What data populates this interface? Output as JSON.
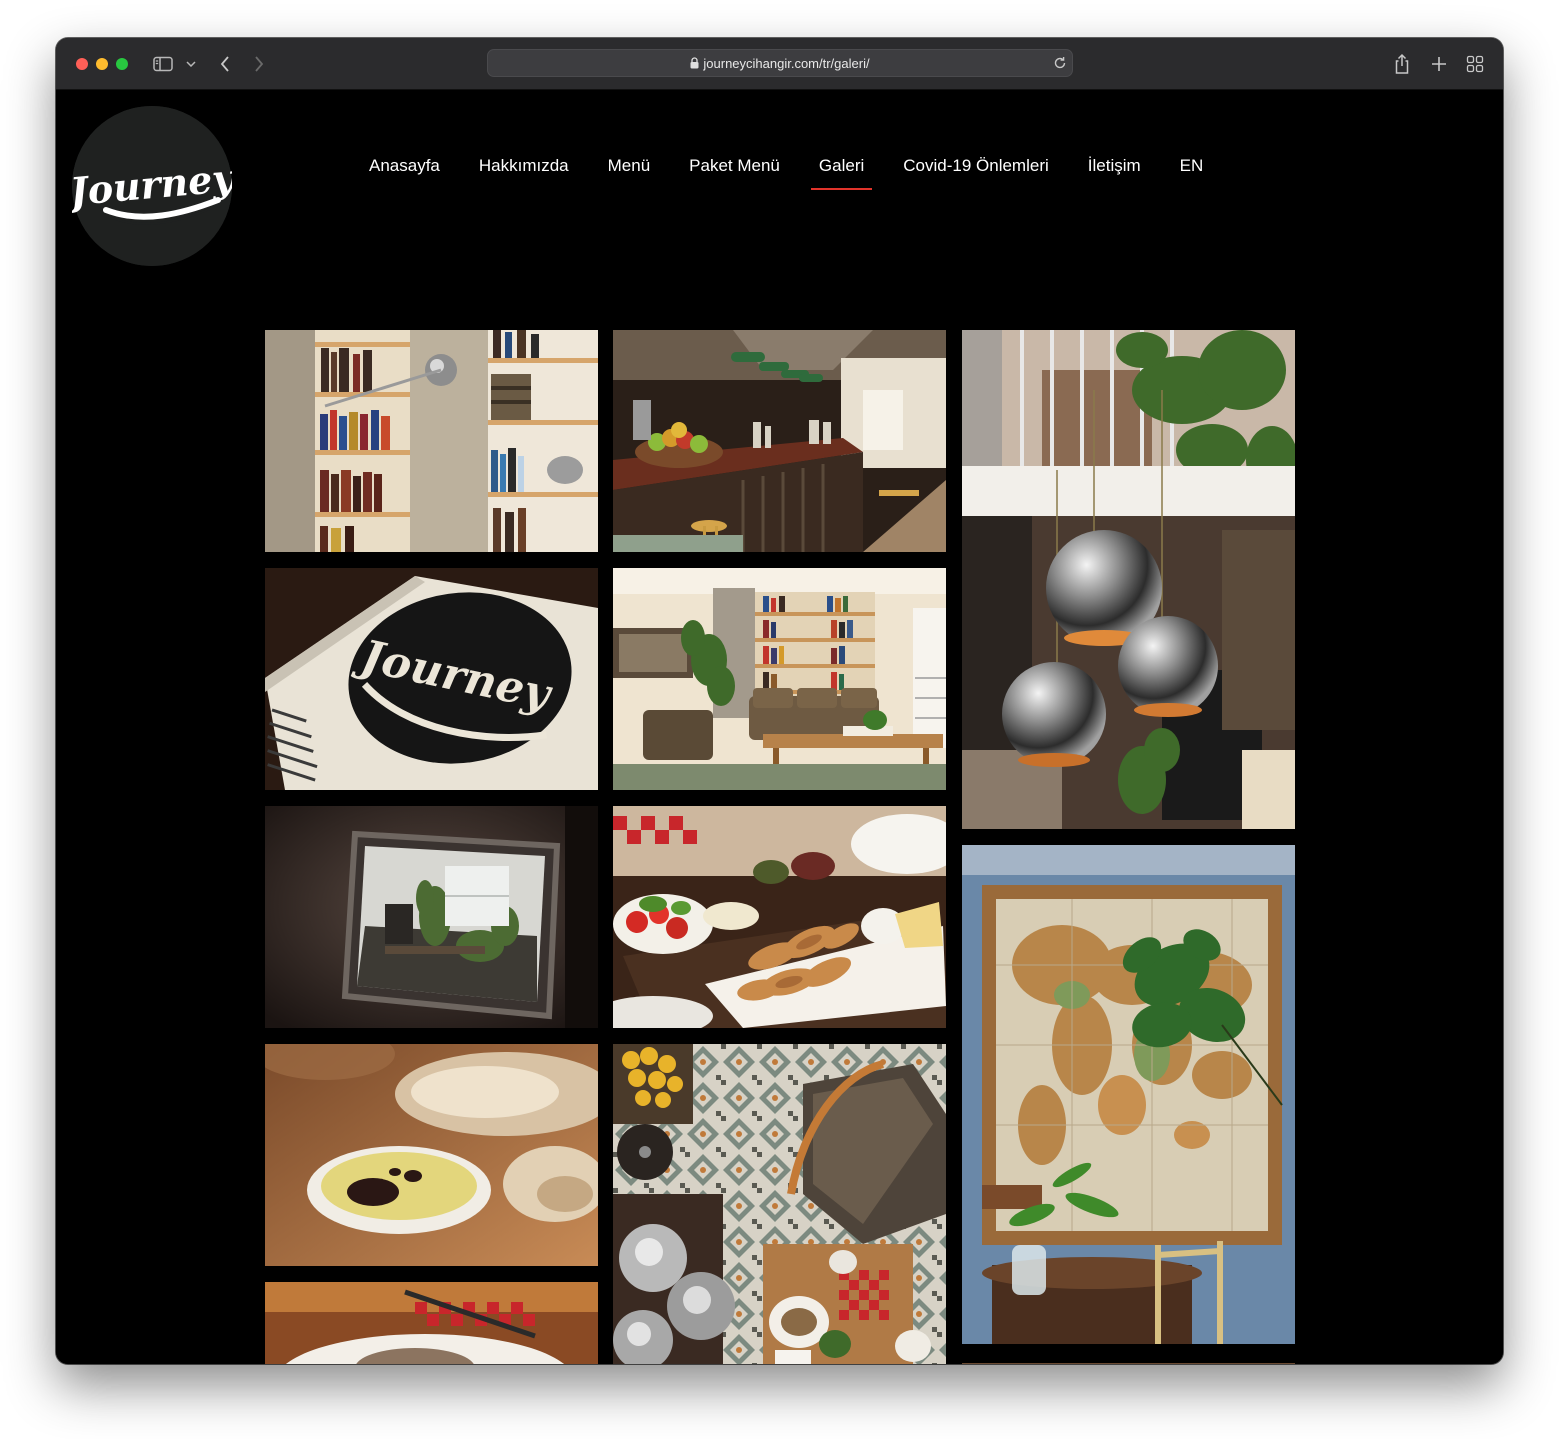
{
  "browser": {
    "url": "journeycihangir.com/tr/galeri/",
    "icons": [
      "sidebar-icon",
      "chevron-down-icon",
      "back-arrow-icon",
      "forward-arrow-icon",
      "lock-icon",
      "reload-icon",
      "share-icon",
      "plus-icon",
      "tab-overview-icon"
    ]
  },
  "site": {
    "logo_text": "Journey",
    "nav": {
      "items": [
        {
          "label": "Anasayfa"
        },
        {
          "label": "Hakkımızda"
        },
        {
          "label": "Menü"
        },
        {
          "label": "Paket Menü"
        },
        {
          "label": "Galeri",
          "active": true
        },
        {
          "label": "Covid-19 Önlemleri"
        },
        {
          "label": "İletişim"
        },
        {
          "label": "EN"
        }
      ],
      "active_color": "#e2342b"
    },
    "gallery": {
      "photos": [
        {
          "subject": "bookshelf-wall"
        },
        {
          "subject": "cafe-counter"
        },
        {
          "subject": "chrome-pendant-lamps"
        },
        {
          "subject": "journey-menu-card"
        },
        {
          "subject": "lounge-bookshelves"
        },
        {
          "subject": "mirror-reflection"
        },
        {
          "subject": "breakfast-plate"
        },
        {
          "subject": "world-map-wall"
        },
        {
          "subject": "bread-olive-oil"
        },
        {
          "subject": "tiled-floor-overhead"
        },
        {
          "subject": "dish-checkered-napkin"
        }
      ]
    }
  }
}
